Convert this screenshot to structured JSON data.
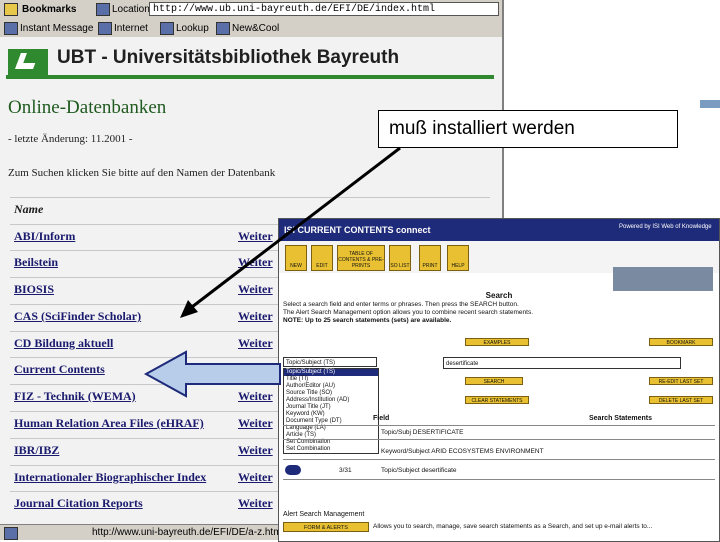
{
  "browser": {
    "toolbar1": {
      "bookmarks_label": "Bookmarks",
      "location_label": "Location:",
      "url": "http://www.ub.uni-bayreuth.de/EFI/DE/index.html"
    },
    "toolbar2": {
      "items": [
        "Instant Message",
        "Internet",
        "Lookup",
        "New&Cool"
      ]
    },
    "status_url": "http://www.uni-bayreuth.de/EFI/DE/a-z.html"
  },
  "page": {
    "library_title": "UBT - Universitätsbibliothek Bayreuth",
    "heading": "Online-Datenbanken",
    "last_change": "- letzte Änderung: 11.2001 -",
    "search_note": "Zum Suchen klicken Sie bitte auf den Namen der Datenbank",
    "table_header": "Name",
    "more_label": "Weiter",
    "databases": [
      "ABI/Inform",
      "Beilstein",
      "BIOSIS",
      "CAS (SciFinder Scholar)",
      "CD Bildung aktuell",
      "Current Contents",
      "FIZ - Technik (WEMA)",
      "Human Relation Area Files (eHRAF)",
      "IBR/IBZ",
      "Internationaler Biographischer Index",
      "Journal Citation Reports"
    ]
  },
  "callout": {
    "text": "muß installiert werden"
  },
  "isi": {
    "title": "ISI CURRENT CONTENTS connect",
    "wok": "Powered by ISI Web of Knowledge",
    "nav_buttons": [
      "NEW",
      "EDIT",
      "TABLE OF CONTENTS & PRE-PRINTS",
      "SO LIST",
      "PRINT",
      "HELP"
    ],
    "search_heading": "Search",
    "instructions": [
      "Select a search field and enter terms or phrases. Then press the SEARCH button.",
      "The Alert Search Management option allows you to combine recent search statements.",
      "NOTE: Up to 25 search statements (sets) are available."
    ],
    "select_value": "Topic/Subject (TS)",
    "dropdown_options": [
      "Topic/Subject (TS)",
      "Title (TI)",
      "Author/Editor (AU)",
      "Source Title (SO)",
      "Address/Institution (AD)",
      "Journal Title (JT)",
      "Keyword (KW)",
      "Document Type (DT)",
      "Language (LA)",
      "Article (TS)",
      "Set Combination",
      "Set Combination"
    ],
    "input_value": "desertificate",
    "ctl_examples": "EXAMPLES",
    "ctl_bookmark": "BOOKMARK",
    "ctl_search": "SEARCH",
    "ctl_last_set": "RE-EDIT LAST SET",
    "ctl_clear": "CLEAR STATEMENTS",
    "ctl_delete": "DELETE LAST SET",
    "field_head": "Field",
    "stmt_head": "Search Statements",
    "row1": "Topic/Subj    DESERTIFICATE",
    "row2": "Keyword/Subject    ARID ECOSYSTEMS ENVIRONMENT",
    "row3_num": "3/31",
    "row3": "Topic/Subject    desertificate",
    "alert": "Alert Search Management",
    "bottom_btn": "FORM & ALERTS",
    "bottom_text": "Allows you to search, manage, save search statements as a Search, and set up e-mail alerts to..."
  }
}
